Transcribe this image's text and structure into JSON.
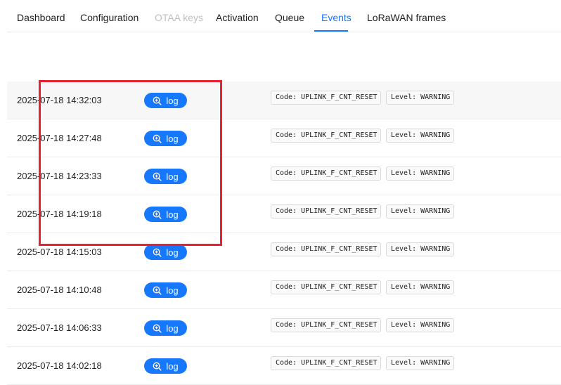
{
  "tabs": [
    {
      "label": "Dashboard",
      "state": "normal"
    },
    {
      "label": "Configuration",
      "state": "normal"
    },
    {
      "label": "OTAA keys",
      "state": "disabled"
    },
    {
      "label": "Activation",
      "state": "normal"
    },
    {
      "label": "Queue",
      "state": "normal"
    },
    {
      "label": "Events",
      "state": "active"
    },
    {
      "label": "LoRaWAN frames",
      "state": "normal"
    }
  ],
  "events": [
    {
      "timestamp": "2025-07-18 14:32:03",
      "button": "log",
      "code": "Code: UPLINK_F_CNT_RESET",
      "level": "Level: WARNING"
    },
    {
      "timestamp": "2025-07-18 14:27:48",
      "button": "log",
      "code": "Code: UPLINK_F_CNT_RESET",
      "level": "Level: WARNING"
    },
    {
      "timestamp": "2025-07-18 14:23:33",
      "button": "log",
      "code": "Code: UPLINK_F_CNT_RESET",
      "level": "Level: WARNING"
    },
    {
      "timestamp": "2025-07-18 14:19:18",
      "button": "log",
      "code": "Code: UPLINK_F_CNT_RESET",
      "level": "Level: WARNING"
    },
    {
      "timestamp": "2025-07-18 14:15:03",
      "button": "log",
      "code": "Code: UPLINK_F_CNT_RESET",
      "level": "Level: WARNING"
    },
    {
      "timestamp": "2025-07-18 14:10:48",
      "button": "log",
      "code": "Code: UPLINK_F_CNT_RESET",
      "level": "Level: WARNING"
    },
    {
      "timestamp": "2025-07-18 14:06:33",
      "button": "log",
      "code": "Code: UPLINK_F_CNT_RESET",
      "level": "Level: WARNING"
    },
    {
      "timestamp": "2025-07-18 14:02:18",
      "button": "log",
      "code": "Code: UPLINK_F_CNT_RESET",
      "level": "Level: WARNING"
    }
  ],
  "colors": {
    "accent": "#1677ff",
    "highlight_box": "#e8212e",
    "disabled_text": "#bfbfbf"
  },
  "icons": {
    "log_button_icon": "zoom-in-icon"
  }
}
